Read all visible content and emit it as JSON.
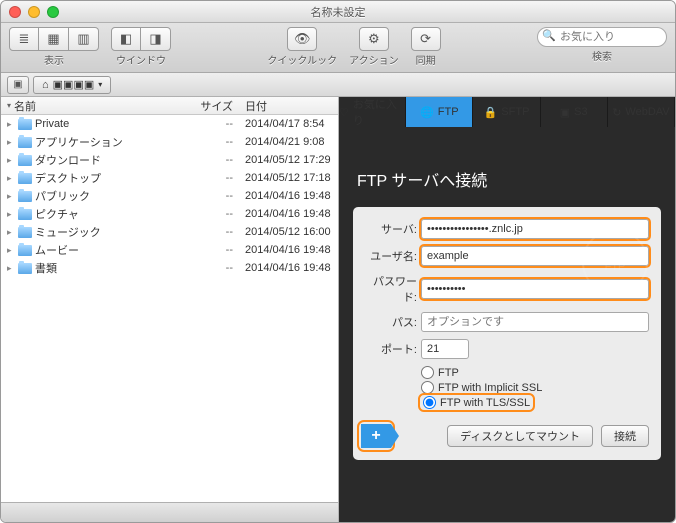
{
  "window": {
    "title": "名称未設定"
  },
  "toolbar": {
    "view_label": "表示",
    "window_label": "ウインドウ",
    "quicklook_label": "クイックルック",
    "action_label": "アクション",
    "sync_label": "同期",
    "search_placeholder": "お気に入り",
    "search_label": "検索"
  },
  "path": {
    "home": "▣▣▣▣"
  },
  "columns": {
    "name": "名前",
    "size": "サイズ",
    "date": "日付"
  },
  "files": [
    {
      "name": "Private",
      "size": "--",
      "date": "2014/04/17 8:54"
    },
    {
      "name": "アプリケーション",
      "size": "--",
      "date": "2014/04/21 9:08"
    },
    {
      "name": "ダウンロード",
      "size": "--",
      "date": "2014/05/12 17:29"
    },
    {
      "name": "デスクトップ",
      "size": "--",
      "date": "2014/05/12 17:18"
    },
    {
      "name": "パブリック",
      "size": "--",
      "date": "2014/04/16 19:48"
    },
    {
      "name": "ピクチャ",
      "size": "--",
      "date": "2014/04/16 19:48"
    },
    {
      "name": "ミュージック",
      "size": "--",
      "date": "2014/05/12 16:00"
    },
    {
      "name": "ムービー",
      "size": "--",
      "date": "2014/04/16 19:48"
    },
    {
      "name": "書類",
      "size": "--",
      "date": "2014/04/16 19:48"
    }
  ],
  "protocols": {
    "fav": "お気に入り",
    "ftp": "FTP",
    "sftp": "SFTP",
    "s3": "S3",
    "webdav": "WebDAV"
  },
  "conn": {
    "heading": "FTP サーバへ接続",
    "server_label": "サーバ:",
    "server_value": "••••••••••••••••.znlc.jp",
    "user_label": "ユーザ名:",
    "user_value": "example",
    "pass_label": "パスワード:",
    "pass_value": "••••••••••",
    "path_label": "パス:",
    "path_placeholder": "オプションです",
    "port_label": "ポート:",
    "port_value": "21",
    "opt_ftp": "FTP",
    "opt_implicit": "FTP with Implicit SSL",
    "opt_tls": "FTP with TLS/SSL",
    "mount_btn": "ディスクとしてマウント",
    "connect_btn": "接続"
  }
}
